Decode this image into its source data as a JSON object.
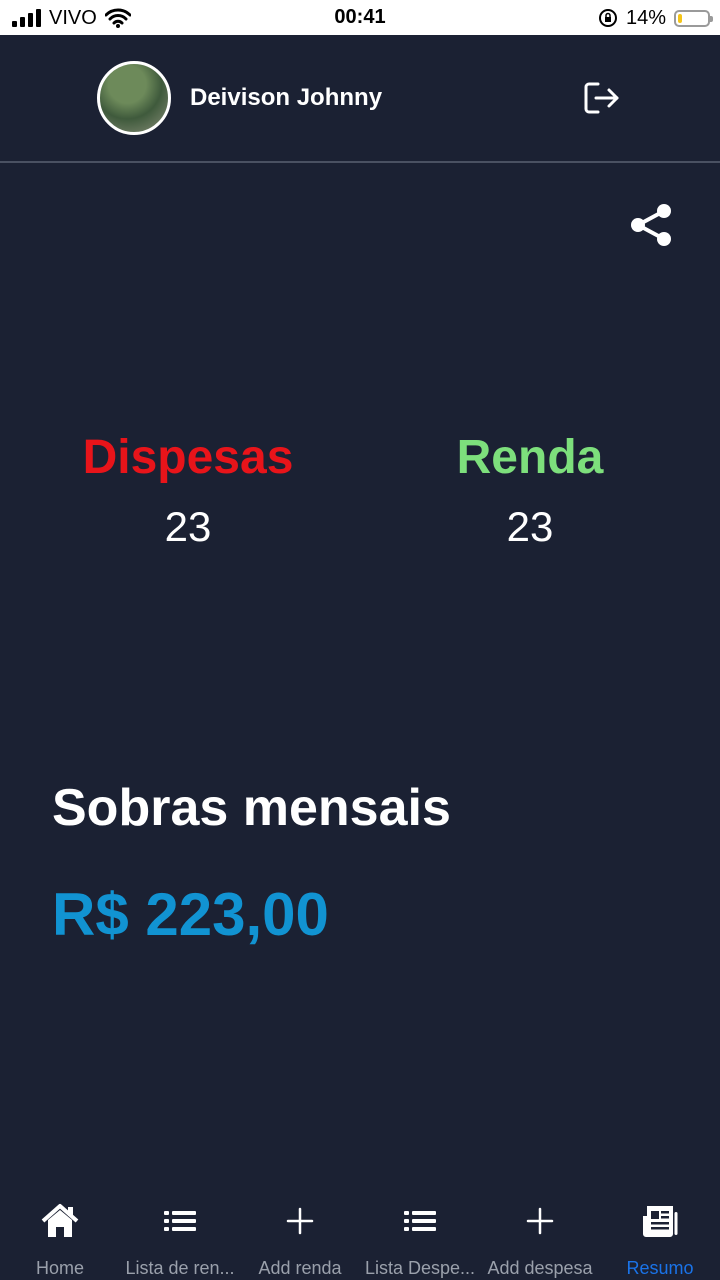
{
  "status_bar": {
    "carrier": "VIVO",
    "time": "00:41",
    "battery_percent": "14%",
    "battery_level": 0.14
  },
  "header": {
    "user_name": "Deivison Johnny"
  },
  "summary": {
    "expenses_label": "Dispesas",
    "expenses_count": "23",
    "income_label": "Renda",
    "income_count": "23",
    "leftover_title": "Sobras mensais",
    "leftover_value": "R$ 223,00"
  },
  "colors": {
    "background": "#1b2133",
    "expenses": "#e8141a",
    "income": "#7ddf7c",
    "leftover": "#1193d2",
    "active_tab": "#1a73e8"
  },
  "bottom_nav": {
    "items": [
      {
        "label": "Home",
        "icon": "home-icon"
      },
      {
        "label": "Lista de ren...",
        "icon": "list-icon"
      },
      {
        "label": "Add renda",
        "icon": "plus-icon"
      },
      {
        "label": "Lista Despe...",
        "icon": "list-icon"
      },
      {
        "label": "Add despesa",
        "icon": "plus-icon"
      },
      {
        "label": "Resumo",
        "icon": "newspaper-icon",
        "active": true
      }
    ]
  }
}
